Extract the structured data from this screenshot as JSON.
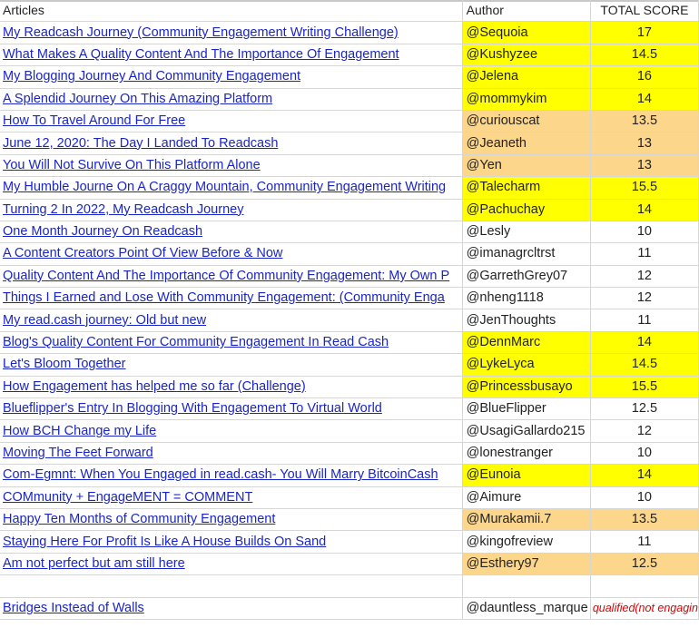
{
  "headers": {
    "articles": "Articles",
    "author": "Author",
    "score": "TOTAL SCORE"
  },
  "colors": {
    "yellow": "#ffff00",
    "orange": "#fcd68a",
    "link": "#1a25c8",
    "disqualified": "#e00000"
  },
  "rows": [
    {
      "article": "My Readcash Journey (Community Engagement Writing Challenge)",
      "author": "@Sequoia",
      "score": "17",
      "hl": "yellow"
    },
    {
      "article": "What Makes A Quality Content And The Importance Of Engagement",
      "author": "@Kushyzee",
      "score": "14.5",
      "hl": "yellow"
    },
    {
      "article": "My Blogging Journey And Community Engagement",
      "author": "@Jelena",
      "score": "16",
      "hl": "yellow"
    },
    {
      "article": "A Splendid Journey On This Amazing Platform",
      "author": "@mommykim",
      "score": "14",
      "hl": "yellow"
    },
    {
      "article": "How To Travel Around For Free",
      "author": "@curiouscat",
      "score": "13.5",
      "hl": "orange"
    },
    {
      "article": "June 12, 2020: The Day I Landed To Readcash",
      "author": "@Jeaneth",
      "score": "13",
      "hl": "orange"
    },
    {
      "article": "You Will Not Survive On This Platform Alone",
      "author": "@Yen",
      "score": "13",
      "hl": "orange"
    },
    {
      "article": "My Humble Journe On A Craggy Mountain, Community Engagement Writing",
      "author": "@Talecharm",
      "score": "15.5",
      "hl": "yellow"
    },
    {
      "article": "Turning 2 In 2022, My Readcash Journey",
      "author": "@Pachuchay",
      "score": "14",
      "hl": "yellow"
    },
    {
      "article": "One Month Journey On Readcash",
      "author": "@Lesly",
      "score": "10",
      "hl": ""
    },
    {
      "article": "A Content Creators Point Of View Before & Now",
      "author": "@imanagrcltrst",
      "score": "11",
      "hl": ""
    },
    {
      "article": "Quality Content And The Importance Of Community Engagement: My Own P",
      "author": "@GarrethGrey07",
      "score": "12",
      "hl": ""
    },
    {
      "article": "Things I Earned and Lose With Community Engagement: (Community Enga",
      "author": "@nheng1118",
      "score": "12",
      "hl": ""
    },
    {
      "article": "My read.cash journey: Old but new",
      "author": "@JenThoughts",
      "score": "11",
      "hl": ""
    },
    {
      "article": "Blog's Quality Content For Community Engagement In Read Cash",
      "author": "@DennMarc",
      "score": "14",
      "hl": "yellow"
    },
    {
      "article": "Let's Bloom Together",
      "author": "@LykeLyca",
      "score": "14.5",
      "hl": "yellow"
    },
    {
      "article": "How Engagement has helped me so far (Challenge)",
      "author": "@Princessbusayo",
      "score": "15.5",
      "hl": "yellow"
    },
    {
      "article": "Blueflipper's Entry In Blogging With Engagement To Virtual World",
      "author": "@BlueFlipper",
      "score": "12.5",
      "hl": ""
    },
    {
      "article": "How BCH Change my Life",
      "author": "@UsagiGallardo215",
      "score": "12",
      "hl": ""
    },
    {
      "article": "Moving The Feet Forward",
      "author": "@lonestranger",
      "score": "10",
      "hl": ""
    },
    {
      "article": "Com-Egmnt: When You Engaged in read.cash- You Will Marry BitcoinCash",
      "author": "@Eunoia",
      "score": "14",
      "hl": "yellow"
    },
    {
      "article": "COMmunity + EngageMENT = COMMENT",
      "author": "@Aimure",
      "score": "10",
      "hl": ""
    },
    {
      "article": "Happy Ten Months of Community Engagement",
      "author": "@Murakamii.7",
      "score": "13.5",
      "hl": "orange"
    },
    {
      "article": "Staying Here For Profit Is Like A House Builds On Sand",
      "author": "@kingofreview",
      "score": "11",
      "hl": ""
    },
    {
      "article": "Am not perfect but am still here",
      "author": "@Esthery97",
      "score": "12.5",
      "hl": "orange"
    }
  ],
  "last_row": {
    "article": "Bridges Instead of Walls",
    "author": "@dauntless_marque",
    "score": "qualified(not engagin"
  }
}
